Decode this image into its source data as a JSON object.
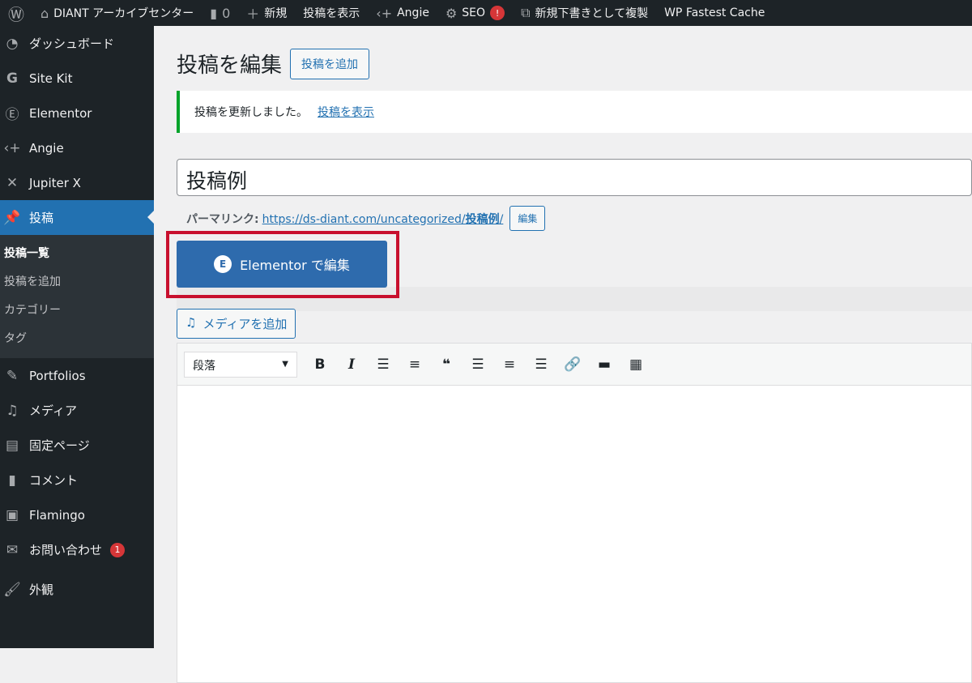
{
  "adminbar": {
    "site": "DIANT アーカイブセンター",
    "comments": "0",
    "new": "新規",
    "view": "投稿を表示",
    "angie": "Angie",
    "seo": "SEO",
    "seo_badge": "!",
    "duplicate": "新規下書きとして複製",
    "cache": "WP Fastest Cache"
  },
  "sidebar": {
    "items": [
      {
        "label": "ダッシュボード",
        "icon": "dashboard-icon"
      },
      {
        "label": "Site Kit",
        "icon": "google-icon"
      },
      {
        "label": "Elementor",
        "icon": "elementor-icon"
      },
      {
        "label": "Angie",
        "icon": "angie-icon"
      },
      {
        "label": "Jupiter X",
        "icon": "jupiter-icon"
      },
      {
        "label": "投稿",
        "icon": "pin-icon"
      }
    ],
    "submenu": [
      "投稿一覧",
      "投稿を追加",
      "カテゴリー",
      "タグ"
    ],
    "items2": [
      {
        "label": "Portfolios",
        "icon": "pin-icon"
      },
      {
        "label": "メディア",
        "icon": "media-icon"
      },
      {
        "label": "固定ページ",
        "icon": "page-icon"
      },
      {
        "label": "コメント",
        "icon": "comment-icon"
      },
      {
        "label": "Flamingo",
        "icon": "flamingo-icon"
      },
      {
        "label": "お問い合わせ",
        "icon": "mail-icon",
        "badge": "1"
      },
      {
        "label": "外観",
        "icon": "brush-icon"
      }
    ]
  },
  "main": {
    "title": "投稿を編集",
    "add_new": "投稿を追加",
    "notice": "投稿を更新しました。",
    "notice_link": "投稿を表示",
    "post_title": "投稿例",
    "permalink_label": "パーマリンク:",
    "permalink_url": "https://ds-diant.com/uncategorized/",
    "permalink_slug": "投稿例",
    "permalink_end": "/",
    "edit": "編集",
    "elementor_btn": "Elementor で編集",
    "media_btn": "メディアを追加",
    "format": "段落"
  }
}
